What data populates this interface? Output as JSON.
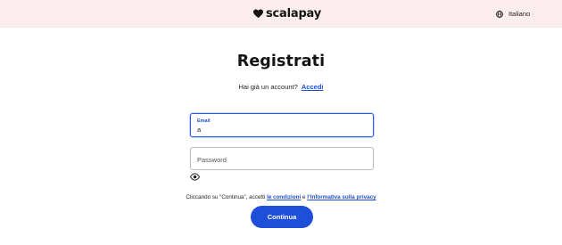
{
  "header": {
    "logo_text": "scalapay",
    "language": "Italiano",
    "logo_icon": "heart-icon",
    "language_icon": "globe-icon"
  },
  "main": {
    "title": "Registrati",
    "login_prompt": "Hai già un account?",
    "login_link": "Accedi",
    "email_field": {
      "label": "Email",
      "value": "a"
    },
    "password_field": {
      "placeholder": "Password",
      "toggle_icon": "eye-icon"
    },
    "consent": {
      "prefix": "Cliccando su “Continua”, accetti ",
      "terms_link": "le condizioni",
      "middle": " e ",
      "privacy_link": "l’Informativa sulla privacy"
    },
    "continue_label": "Continua"
  },
  "colors": {
    "accent": "#1f4fd8",
    "header_bg": "#fceeee",
    "text": "#141414"
  }
}
